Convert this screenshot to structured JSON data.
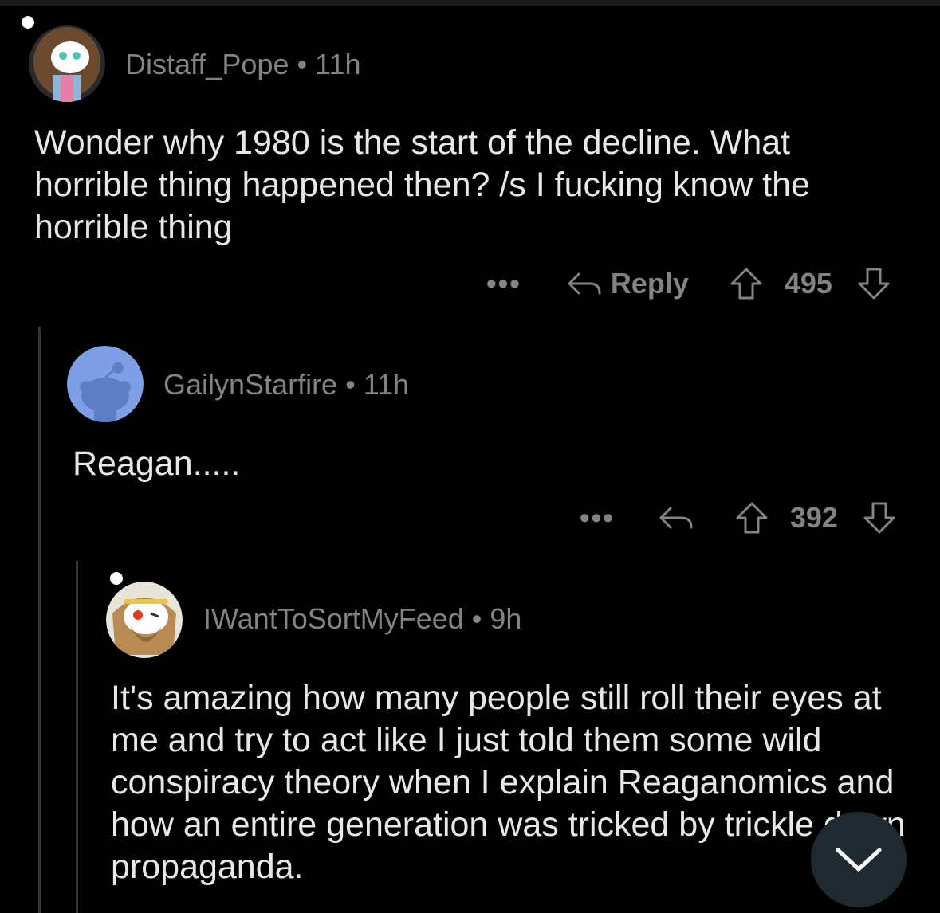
{
  "comments": [
    {
      "username": "Distaff_Pope",
      "age": "11h",
      "body": "Wonder why 1980 is the start of the decline. What horrible thing happened then? /s I fucking know the horrible thing",
      "reply_label": "Reply",
      "score": "495"
    },
    {
      "username": "GailynStarfire",
      "age": "11h",
      "body": "Reagan.....",
      "score": "392"
    },
    {
      "username": "IWantToSortMyFeed",
      "age": "9h",
      "body": "It's amazing how many people still roll their eyes at me and try to act like I just told them some wild conspiracy theory when I explain Reaganomics and how an entire generation was tricked by trickle down propaganda."
    }
  ],
  "meta_separator": "•",
  "more_label": "•••",
  "icons": {
    "reply": "reply-arrow-icon",
    "upvote": "upvote-arrow-icon",
    "downvote": "downvote-arrow-icon",
    "scroll": "chevron-down-icon"
  },
  "colors": {
    "background": "#000000",
    "text": "#e6e7e8",
    "muted": "#818384",
    "fab": "#1f2a30"
  }
}
